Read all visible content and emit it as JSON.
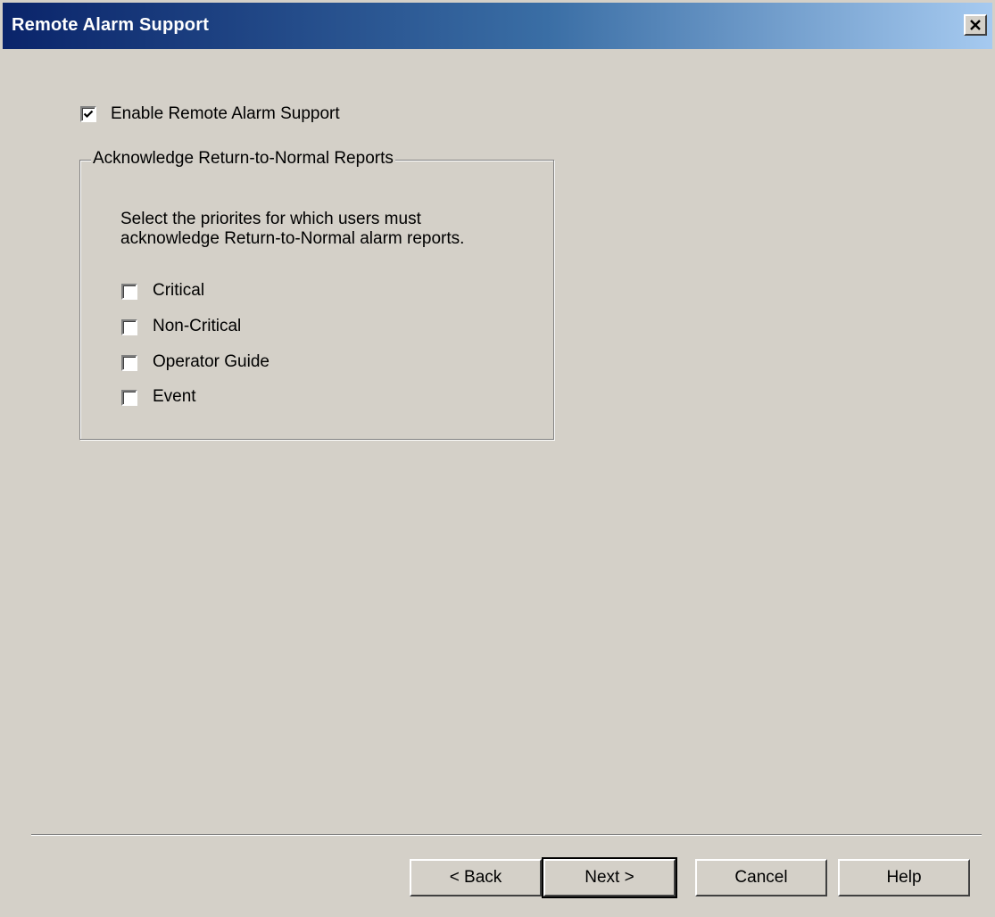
{
  "window": {
    "title": "Remote Alarm Support",
    "close_glyph": "×"
  },
  "enable": {
    "label": "Enable Remote Alarm Support",
    "checked": true
  },
  "group": {
    "legend": "Acknowledge Return-to-Normal Reports",
    "description_line1": "Select the priorites for which users must",
    "description_line2": "acknowledge Return-to-Normal alarm reports.",
    "priorities": [
      {
        "label": "Critical",
        "checked": false
      },
      {
        "label": "Non-Critical",
        "checked": false
      },
      {
        "label": "Operator Guide",
        "checked": false
      },
      {
        "label": "Event",
        "checked": false
      }
    ]
  },
  "buttons": {
    "back": "< Back",
    "next": "Next >",
    "cancel": "Cancel",
    "help": "Help"
  },
  "colors": {
    "dialog_bg": "#d4d0c8",
    "title_gradient_start": "#0a246a",
    "title_gradient_end": "#a6caf0"
  }
}
